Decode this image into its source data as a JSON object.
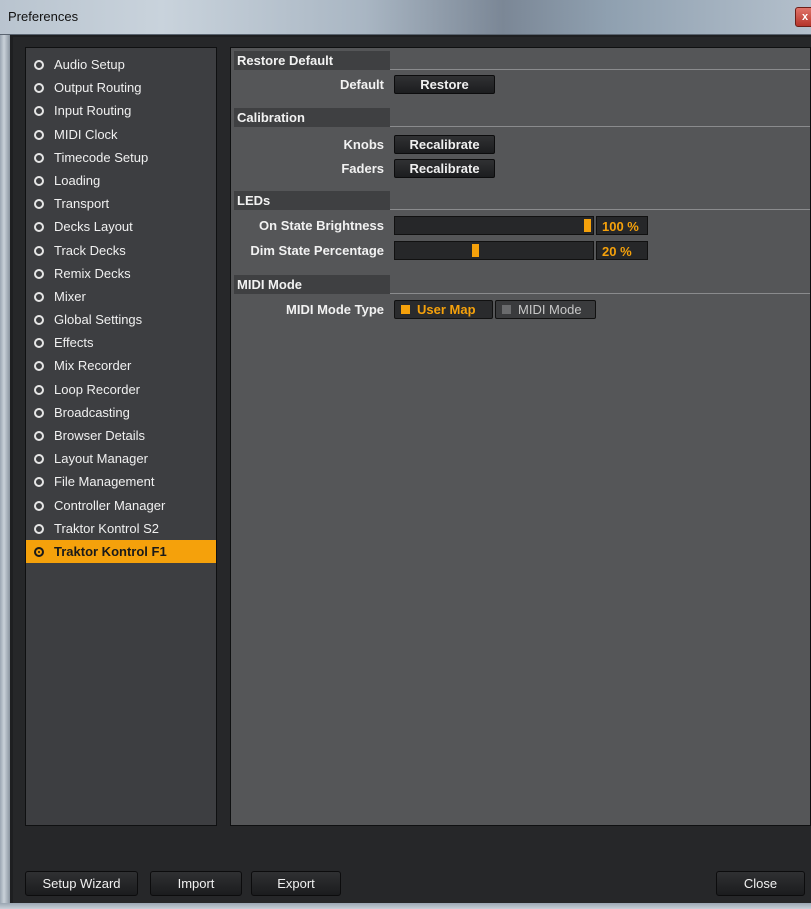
{
  "window": {
    "title": "Preferences",
    "close_glyph": "x"
  },
  "sidebar": {
    "items": [
      {
        "label": "Audio Setup"
      },
      {
        "label": "Output Routing"
      },
      {
        "label": "Input Routing"
      },
      {
        "label": "MIDI Clock"
      },
      {
        "label": "Timecode Setup"
      },
      {
        "label": "Loading"
      },
      {
        "label": "Transport"
      },
      {
        "label": "Decks Layout"
      },
      {
        "label": "Track Decks"
      },
      {
        "label": "Remix Decks"
      },
      {
        "label": "Mixer"
      },
      {
        "label": "Global Settings"
      },
      {
        "label": "Effects"
      },
      {
        "label": "Mix Recorder"
      },
      {
        "label": "Loop Recorder"
      },
      {
        "label": "Broadcasting"
      },
      {
        "label": "Browser Details"
      },
      {
        "label": "Layout Manager"
      },
      {
        "label": "File Management"
      },
      {
        "label": "Controller Manager"
      },
      {
        "label": "Traktor Kontrol S2"
      },
      {
        "label": "Traktor Kontrol F1"
      }
    ],
    "selected": "Traktor Kontrol F1"
  },
  "main": {
    "restore": {
      "heading": "Restore Default",
      "label": "Default",
      "button": "Restore"
    },
    "calibration": {
      "heading": "Calibration",
      "knobs_label": "Knobs",
      "knobs_button": "Recalibrate",
      "faders_label": "Faders",
      "faders_button": "Recalibrate"
    },
    "leds": {
      "heading": "LEDs",
      "on_label": "On State Brightness",
      "on_value_text": "100 %",
      "on_value": 1.0,
      "dim_label": "Dim State Percentage",
      "dim_value_text": "20 %",
      "dim_value": 0.4
    },
    "midi": {
      "heading": "MIDI Mode",
      "label": "MIDI Mode Type",
      "option_user": "User Map",
      "option_midi": "MIDI Mode",
      "selected": "User Map"
    }
  },
  "footer": {
    "setup_wizard": "Setup Wizard",
    "import": "Import",
    "export": "Export",
    "close": "Close"
  },
  "colors": {
    "accent": "#f5a10b",
    "panel": "#555658",
    "nav": "#3d3e41"
  }
}
